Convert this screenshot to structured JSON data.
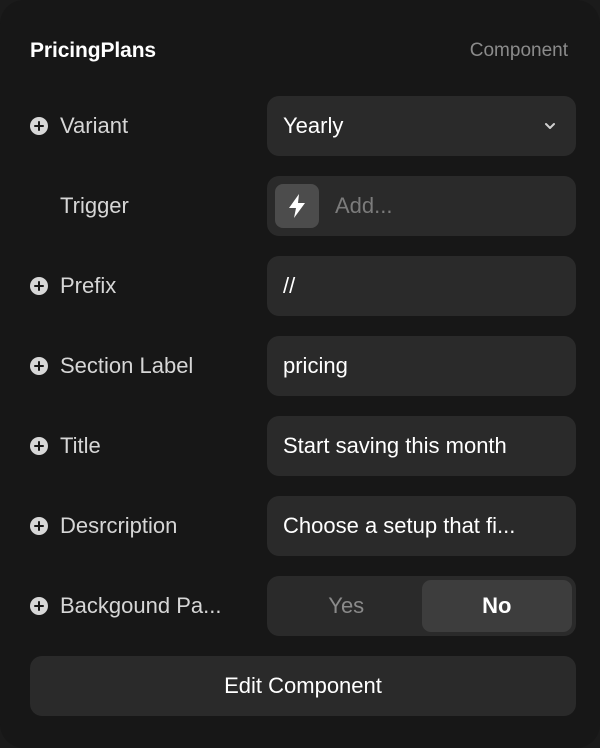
{
  "header": {
    "title": "PricingPlans",
    "badge": "Component"
  },
  "fields": {
    "variant": {
      "label": "Variant",
      "value": "Yearly"
    },
    "trigger": {
      "label": "Trigger",
      "placeholder": "Add..."
    },
    "prefix": {
      "label": "Prefix",
      "value": "//"
    },
    "section_label": {
      "label": "Section Label",
      "value": "pricing"
    },
    "title": {
      "label": "Title",
      "value": "Start saving this month"
    },
    "description": {
      "label": "Desrcription",
      "value": "Choose a setup that fi..."
    },
    "background": {
      "label": "Backgound Pa...",
      "options": [
        "Yes",
        "No"
      ],
      "selected": "No"
    }
  },
  "actions": {
    "edit_label": "Edit Component"
  },
  "icons": {
    "add": "plus-circle-icon",
    "dropdown": "chevron-down-icon",
    "trigger": "lightning-bolt-icon"
  },
  "colors": {
    "panel": "#171717",
    "field": "#2a2a2a",
    "toggle_active": "#3d3d3d"
  }
}
